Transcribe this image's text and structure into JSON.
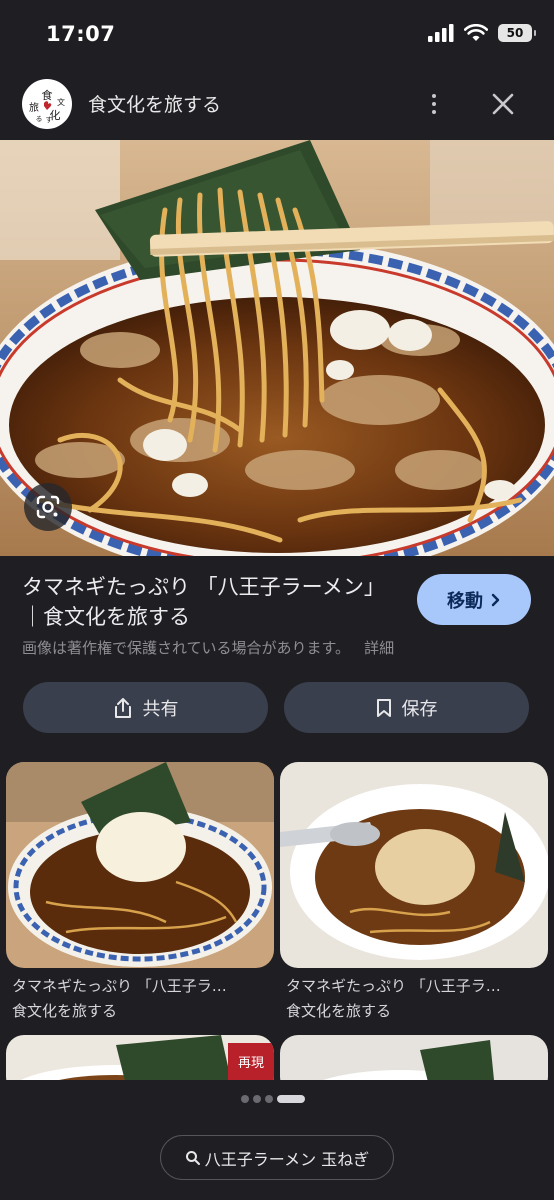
{
  "status_bar": {
    "time": "17:07",
    "battery": "50"
  },
  "header": {
    "site_name": "食文化を旅する",
    "logo_chars": [
      "食",
      "文",
      "化",
      "旅",
      "る",
      "す"
    ]
  },
  "result": {
    "title": "タマネギたっぷり 「八王子ラーメン」｜食文化を旅する",
    "go_label": "移動",
    "copyright": "画像は著作権で保護されている場合があります。",
    "details_label": "詳細"
  },
  "actions": {
    "share_label": "共有",
    "save_label": "保存"
  },
  "related": [
    {
      "title": "タマネギたっぷり 「八王子ラ…",
      "source": "食文化を旅する"
    },
    {
      "title": "タマネギたっぷり 「八王子ラ…",
      "source": "食文化を旅する"
    }
  ],
  "partial_thumb_badge": "再現",
  "pager": {
    "count": 4,
    "active_index": 3
  },
  "search_chip": {
    "label": "八王子ラーメン 玉ねぎ"
  },
  "colors": {
    "background": "#1f1f23",
    "accent_button": "#a8c7fa",
    "action_button": "#3a3f4d"
  }
}
